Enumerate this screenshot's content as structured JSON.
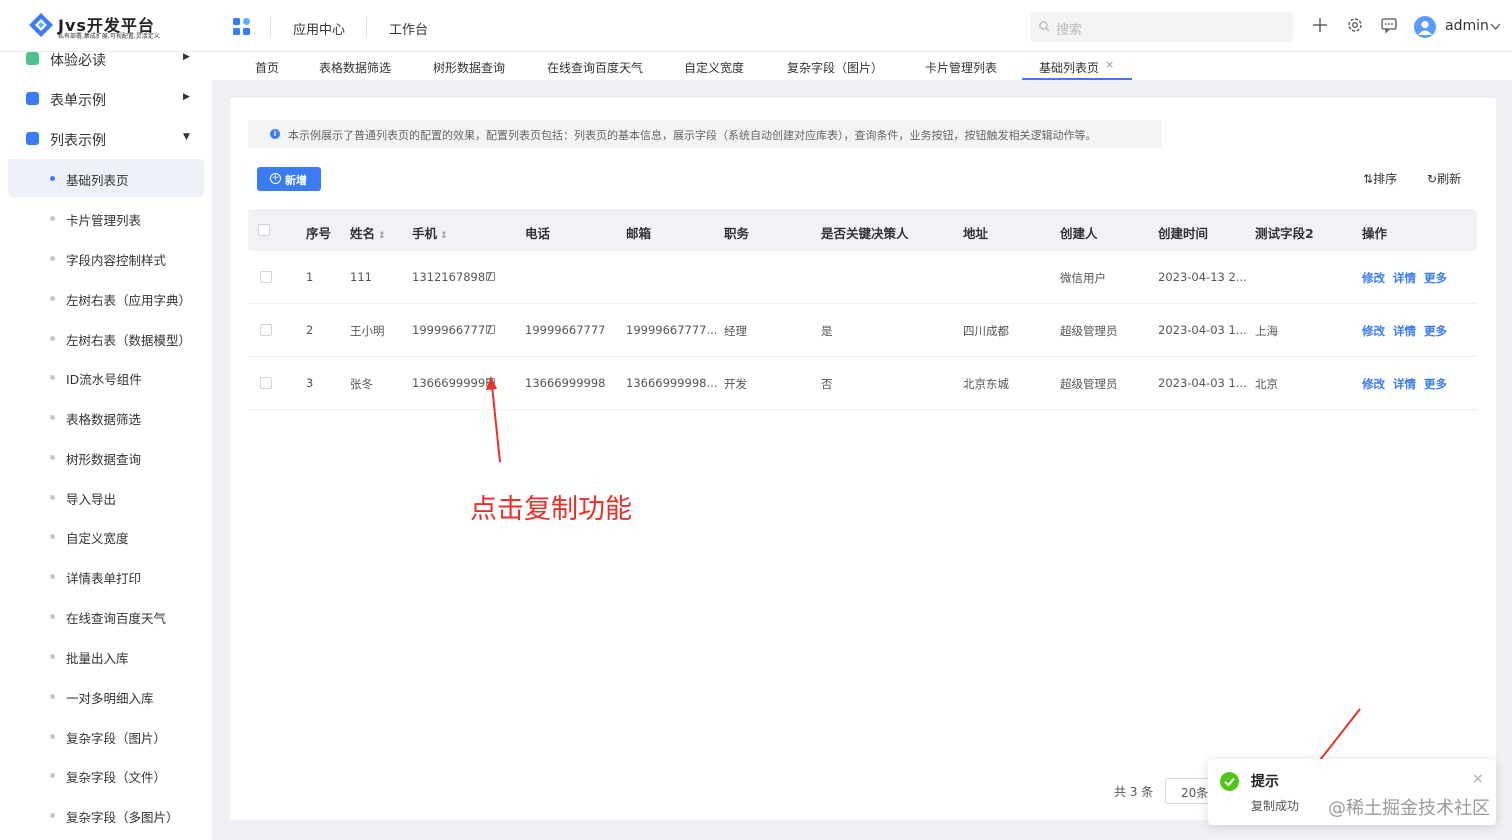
{
  "header": {
    "logo_title": "Jvs开发平台",
    "logo_subtitle": "私有部署,集成扩展,可视配置,灵活定义",
    "nav": [
      "应用中心",
      "工作台"
    ],
    "search_placeholder": "搜索",
    "user": "admin"
  },
  "sidebar": {
    "groups": [
      {
        "label": "体验必读",
        "icon_color": "#4cc28a"
      },
      {
        "label": "表单示例",
        "icon_color": "#3b7cf6"
      },
      {
        "label": "列表示例",
        "icon_color": "#3b7cf6"
      }
    ],
    "items": [
      "基础列表页",
      "卡片管理列表",
      "字段内容控制样式",
      "左树右表（应用字典）",
      "左树右表（数据模型）",
      "ID流水号组件",
      "表格数据筛选",
      "树形数据查询",
      "导入导出",
      "自定义宽度",
      "详情表单打印",
      "在线查询百度天气",
      "批量出入库",
      "一对多明细入库",
      "复杂字段（图片）",
      "复杂字段（文件）",
      "复杂字段（多图片）"
    ],
    "active_index": 0
  },
  "tabs": [
    "首页",
    "表格数据筛选",
    "树形数据查询",
    "在线查询百度天气",
    "自定义宽度",
    "复杂字段（图片）",
    "卡片管理列表",
    "基础列表页"
  ],
  "active_tab": "基础列表页",
  "notice": "本示例展示了普通列表页的配置的效果，配置列表页包括：列表页的基本信息，展示字段（系统自动创建对应库表），查询条件，业务按钮，按钮触发相关逻辑动作等。",
  "toolbar": {
    "add": "新增",
    "sort": "排序",
    "refresh": "刷新"
  },
  "table": {
    "columns": [
      "序号",
      "姓名",
      "手机",
      "电话",
      "邮箱",
      "职务",
      "是否关键决策人",
      "地址",
      "创建人",
      "创建时间",
      "测试字段2",
      "操作"
    ],
    "rows": [
      {
        "no": "1",
        "name": "111",
        "mobile": "13121678987",
        "phone": "",
        "email": "",
        "title": "",
        "key": "",
        "addr": "",
        "creator": "微信用户",
        "created": "2023-04-13 2...",
        "test": ""
      },
      {
        "no": "2",
        "name": "王小明",
        "mobile": "19999667777",
        "phone": "19999667777",
        "email": "19999667777...",
        "title": "经理",
        "key": "是",
        "addr": "四川成都",
        "creator": "超级管理员",
        "created": "2023-04-03 1...",
        "test": "上海"
      },
      {
        "no": "3",
        "name": "张冬",
        "mobile": "13666999998",
        "phone": "13666999998",
        "email": "13666999998...",
        "title": "开发",
        "key": "否",
        "addr": "北京东城",
        "creator": "超级管理员",
        "created": "2023-04-03 1...",
        "test": "北京"
      }
    ],
    "actions": [
      "修改",
      "详情",
      "更多"
    ]
  },
  "annotation": "点击复制功能",
  "pagination": {
    "total": "共 3 条",
    "page_size": "20条"
  },
  "toast": {
    "title": "提示",
    "message": "复制成功"
  },
  "watermark": "@稀土掘金技术社区",
  "colors": {
    "accent": "#3b7cf6",
    "success": "#52c41a",
    "annotation": "#e8312a"
  }
}
